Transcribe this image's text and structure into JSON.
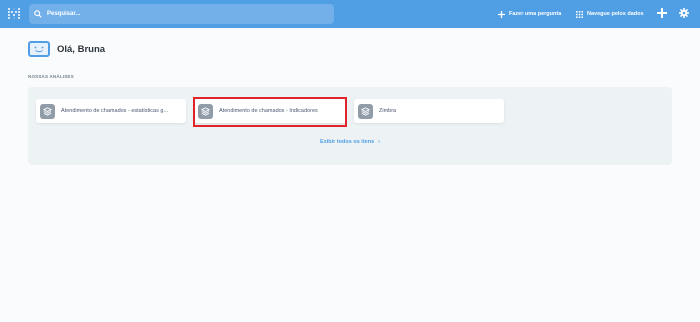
{
  "nav": {
    "search_placeholder": "Pesquisar...",
    "ask_label": "Fazer uma pergunta",
    "browse_label": "Navegue pelos dados"
  },
  "greeting": {
    "text": "Olá, Bruna"
  },
  "section": {
    "label": "NOSSAS ANÁLISES"
  },
  "collections": [
    {
      "label": "Atendimento de chamados - estatísticas g..."
    },
    {
      "label": "Atendimento de chamados - Indicadores"
    },
    {
      "label": "Zimbra"
    }
  ],
  "view_all": {
    "label": "Exibir todos os itens"
  },
  "colors": {
    "brand": "#509ee3",
    "highlight": "#e0252a"
  }
}
